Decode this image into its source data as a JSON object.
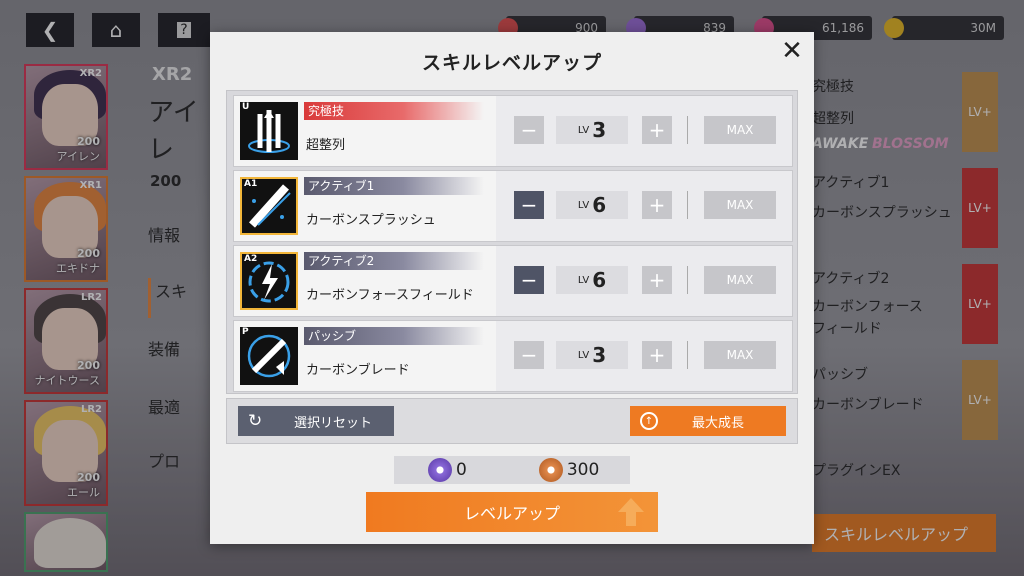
{
  "background": {
    "topbar": {
      "back_icon": "chevron-left-icon",
      "home_icon": "home-icon",
      "help_icon": "question-icon",
      "resources": [
        {
          "value": "900",
          "color": "#e04a4a"
        },
        {
          "value": "839",
          "color": "#9a6ad8"
        },
        {
          "value": "61,186",
          "color": "#e04a8a"
        },
        {
          "value": "30M",
          "color": "#e8b820"
        }
      ]
    },
    "characters": [
      {
        "name": "アイレン",
        "level": "200",
        "rank": "XR2",
        "hair": "#3a2a4a"
      },
      {
        "name": "エキドナ",
        "level": "200",
        "rank": "XR1",
        "hair": "#e8853a"
      },
      {
        "name": "ナイトウース",
        "level": "200",
        "rank": "LR2",
        "hair": "#4a4040"
      },
      {
        "name": "エール",
        "level": "200",
        "rank": "LR2",
        "hair": "#f0c860"
      },
      {
        "name": "",
        "level": "",
        "rank": "",
        "hair": "#e8e0d8"
      }
    ],
    "hero": {
      "rank": "XR2",
      "name": "アイレ",
      "level": "200"
    },
    "menu": [
      "情報",
      "スキ",
      "装備",
      "最適",
      "プロ"
    ],
    "right_panel": {
      "rows": [
        "究極技",
        "超整列",
        "アクティブ1",
        "カーボンスプラッシュ",
        "アクティブ2",
        "カーボンフォース",
        "フィールド",
        "パッシブ",
        "カーボンブレード",
        "プラグインEX"
      ],
      "awake": "AWAKE",
      "blossom": "BLOSSOM",
      "lv_label": "LV+",
      "bottom_button": "スキルレベルアップ"
    }
  },
  "modal": {
    "title": "スキルレベルアップ",
    "close_icon": "close-icon",
    "skills": [
      {
        "badge": "U",
        "type": "究極技",
        "name": "超整列",
        "lv_label": "LV",
        "level": "3",
        "minus_enabled": false,
        "max_label": "MAX"
      },
      {
        "badge": "A1",
        "type": "アクティブ1",
        "name": "カーボンスプラッシュ",
        "lv_label": "LV",
        "level": "6",
        "minus_enabled": true,
        "max_label": "MAX"
      },
      {
        "badge": "A2",
        "type": "アクティブ2",
        "name": "カーボンフォースフィールド",
        "lv_label": "LV",
        "level": "6",
        "minus_enabled": true,
        "max_label": "MAX"
      },
      {
        "badge": "P",
        "type": "パッシブ",
        "name": "カーボンブレード",
        "lv_label": "LV",
        "level": "3",
        "minus_enabled": false,
        "max_label": "MAX"
      }
    ],
    "reset_button": "選択リセット",
    "max_growth_button": "最大成長",
    "costs": [
      {
        "value": "0",
        "color": "#8a6ad8"
      },
      {
        "value": "300",
        "color": "#e0884a"
      }
    ],
    "levelup_button": "レベルアップ",
    "minus_glyph": "−",
    "plus_glyph": "+"
  }
}
